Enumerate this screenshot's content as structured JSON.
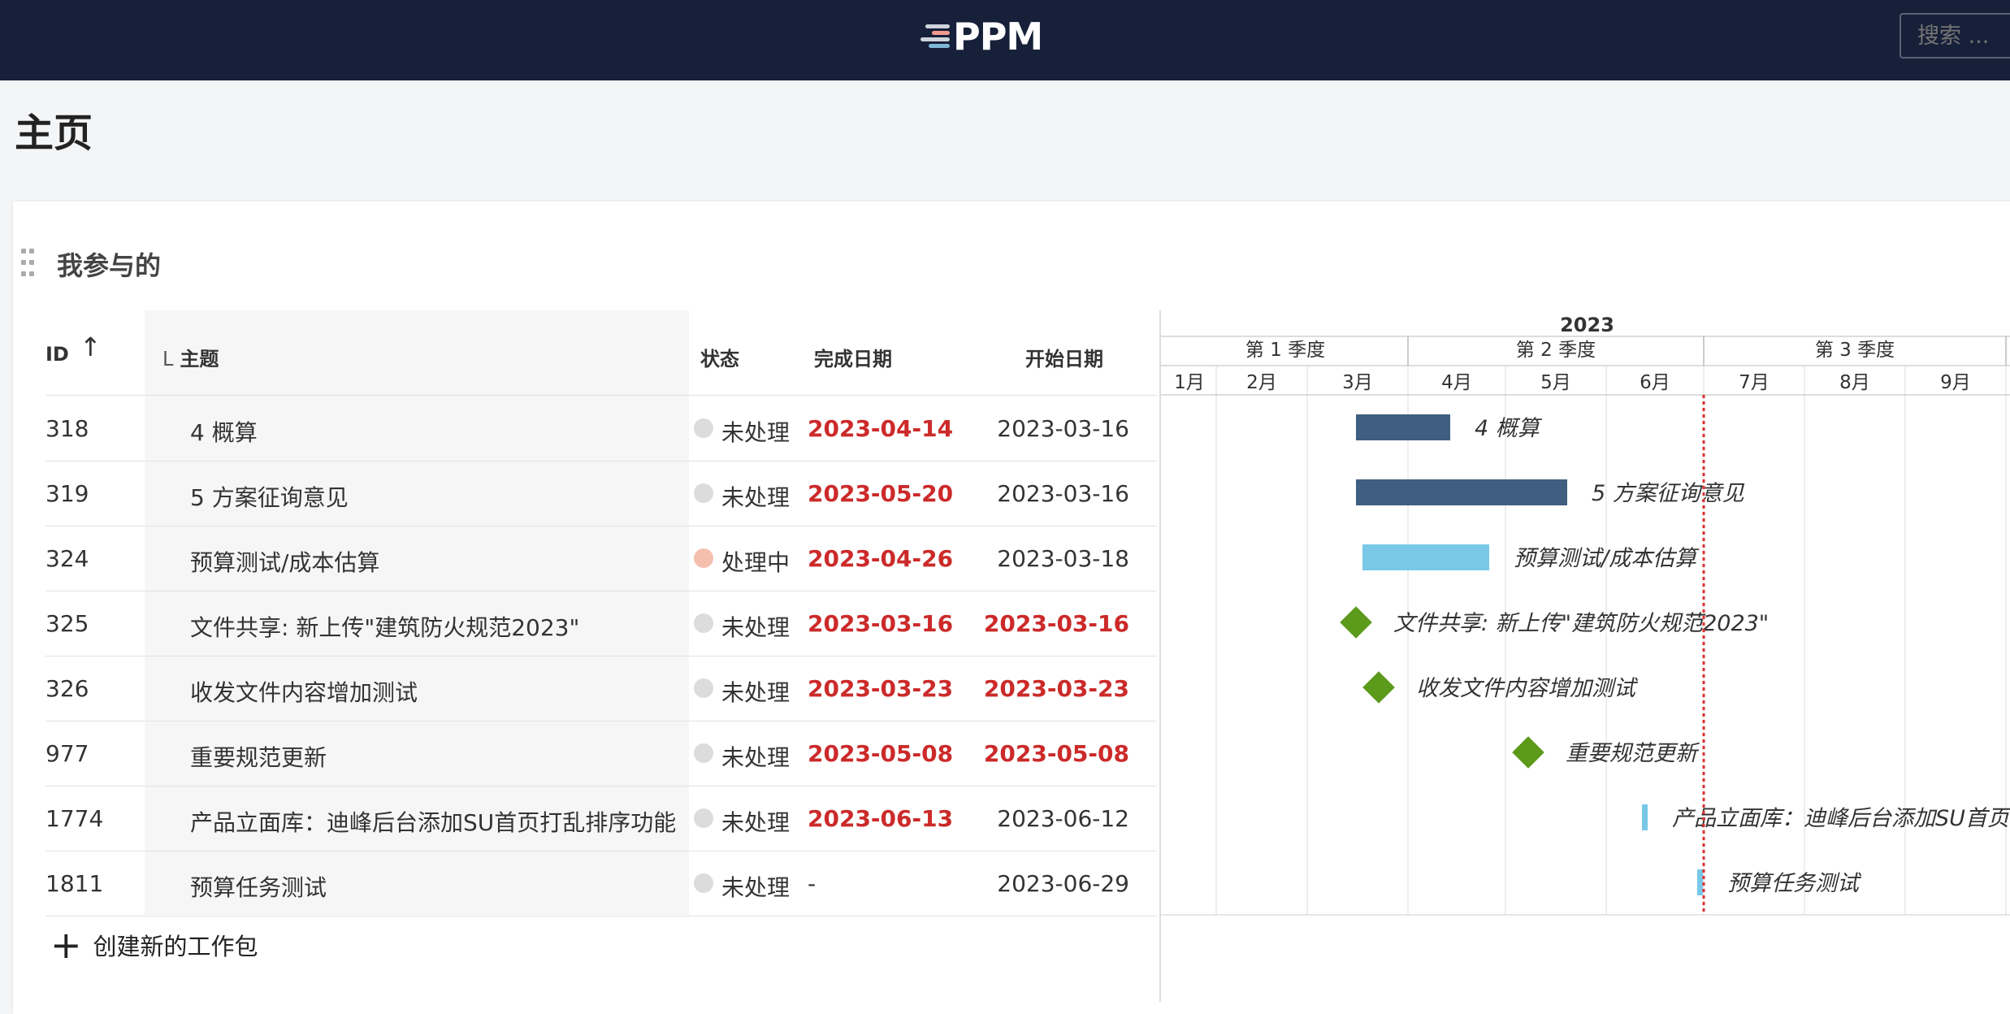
{
  "header": {
    "logo_text": "PPM",
    "search_placeholder": "搜索 ..."
  },
  "page": {
    "title": "主页"
  },
  "widget": {
    "title": "我参与的",
    "columns": {
      "id": "ID",
      "subject": "主题",
      "status": "状态",
      "due": "完成日期",
      "start": "开始日期"
    },
    "rows": [
      {
        "id": "318",
        "subject": "4 概算",
        "status": "未处理",
        "status_color": "#dcdcdc",
        "due": "2023-04-14",
        "due_overdue": true,
        "start": "2023-03-16",
        "start_overdue": false
      },
      {
        "id": "319",
        "subject": "5 方案征询意见",
        "status": "未处理",
        "status_color": "#dcdcdc",
        "due": "2023-05-20",
        "due_overdue": true,
        "start": "2023-03-16",
        "start_overdue": false
      },
      {
        "id": "324",
        "subject": "预算测试/成本估算",
        "status": "处理中",
        "status_color": "#f5bfae",
        "due": "2023-04-26",
        "due_overdue": true,
        "start": "2023-03-18",
        "start_overdue": false
      },
      {
        "id": "325",
        "subject": "文件共享: 新上传\"建筑防火规范2023\"",
        "status": "未处理",
        "status_color": "#dcdcdc",
        "due": "2023-03-16",
        "due_overdue": true,
        "start": "2023-03-16",
        "start_overdue": true
      },
      {
        "id": "326",
        "subject": "收发文件内容增加测试",
        "status": "未处理",
        "status_color": "#dcdcdc",
        "due": "2023-03-23",
        "due_overdue": true,
        "start": "2023-03-23",
        "start_overdue": true
      },
      {
        "id": "977",
        "subject": "重要规范更新",
        "status": "未处理",
        "status_color": "#dcdcdc",
        "due": "2023-05-08",
        "due_overdue": true,
        "start": "2023-05-08",
        "start_overdue": true
      },
      {
        "id": "1774",
        "subject": "产品立面库：迪峰后台添加SU首页打乱排序功能",
        "status": "未处理",
        "status_color": "#dcdcdc",
        "due": "2023-06-13",
        "due_overdue": true,
        "start": "2023-06-12",
        "start_overdue": false
      },
      {
        "id": "1811",
        "subject": "预算任务测试",
        "status": "未处理",
        "status_color": "#dcdcdc",
        "due": "-",
        "due_overdue": false,
        "start": "2023-06-29",
        "start_overdue": false
      }
    ],
    "create_label": "创建新的工作包"
  },
  "gantt": {
    "year": "2023",
    "quarters": [
      "第 1 季度",
      "第 2 季度",
      "第 3 季度"
    ],
    "months": [
      "1月",
      "2月",
      "3月",
      "4月",
      "5月",
      "6月",
      "7月",
      "8月",
      "9月"
    ],
    "today": "2023-07-01",
    "colors": {
      "bar_dark": "#3f5e80",
      "bar_light": "#78c8e6",
      "milestone": "#5b9a1a",
      "today_line": "#e03030"
    },
    "items": [
      {
        "label": "4 概算",
        "kind": "bar",
        "start": "2023-03-16",
        "end": "2023-04-14",
        "color": "#3f5e80"
      },
      {
        "label": "5 方案征询意见",
        "kind": "bar",
        "start": "2023-03-16",
        "end": "2023-05-20",
        "color": "#3f5e80"
      },
      {
        "label": "预算测试/成本估算",
        "kind": "bar",
        "start": "2023-03-18",
        "end": "2023-04-26",
        "color": "#78c8e6"
      },
      {
        "label": "文件共享: 新上传\"建筑防火规范2023\"",
        "kind": "milestone",
        "date": "2023-03-16",
        "color": "#5b9a1a"
      },
      {
        "label": "收发文件内容增加测试",
        "kind": "milestone",
        "date": "2023-03-23",
        "color": "#5b9a1a"
      },
      {
        "label": "重要规范更新",
        "kind": "milestone",
        "date": "2023-05-08",
        "color": "#5b9a1a"
      },
      {
        "label": "产品立面库：迪峰后台添加SU首页打乱排序功能",
        "kind": "bar",
        "start": "2023-06-12",
        "end": "2023-06-13",
        "color": "#78c8e6"
      },
      {
        "label": "预算任务测试",
        "kind": "bar",
        "start": "2023-06-29",
        "end": "2023-06-30",
        "color": "#78c8e6"
      }
    ]
  }
}
